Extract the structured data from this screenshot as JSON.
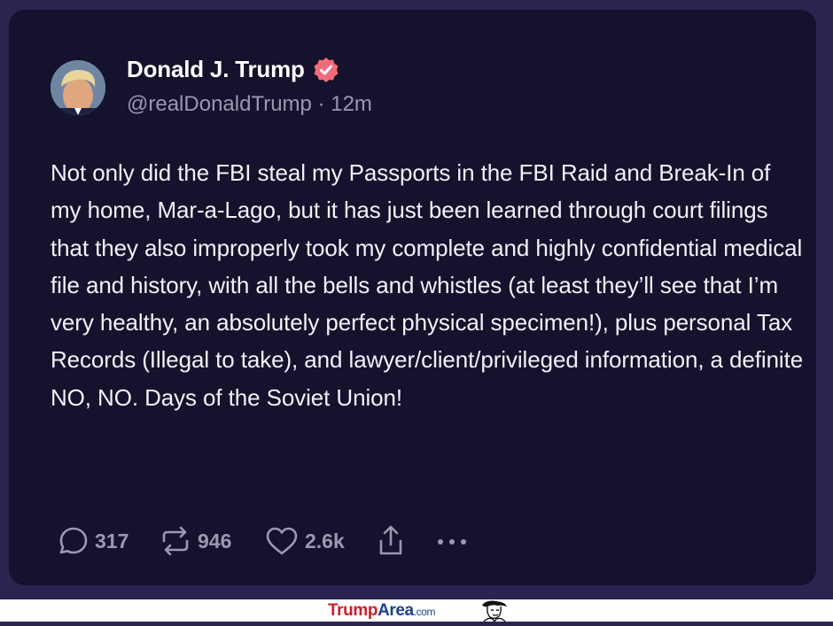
{
  "post": {
    "author_name": "Donald J. Trump",
    "handle": "@realDonaldTrump",
    "separator": " · ",
    "time": "12m",
    "body": "Not only did the FBI steal my Passports in the FBI Raid and Break-In of my home, Mar-a-Lago, but it has just been learned through court filings that they also improperly took my complete and highly confidential medical file and history, with all the bells and whistles (at least they’ll see that I’m very healthy, an absolutely perfect physical specimen!), plus personal Tax Records (Illegal to take), and lawyer/client/privileged information, a definite NO, NO. Days of the Soviet Union!",
    "verified_badge_color": "#f26b7a"
  },
  "actions": {
    "replies": "317",
    "reposts": "946",
    "likes": "2.6k",
    "icons": [
      "reply-icon",
      "repost-icon",
      "like-icon",
      "share-icon",
      "more-icon"
    ]
  },
  "footer": {
    "brand_part1": "Trump",
    "brand_part2": "Area",
    "brand_part3": ".com"
  },
  "colors": {
    "background": "#2a2550",
    "card": "#14122c",
    "text": "#f2f1f7",
    "muted": "#9b98b0"
  }
}
